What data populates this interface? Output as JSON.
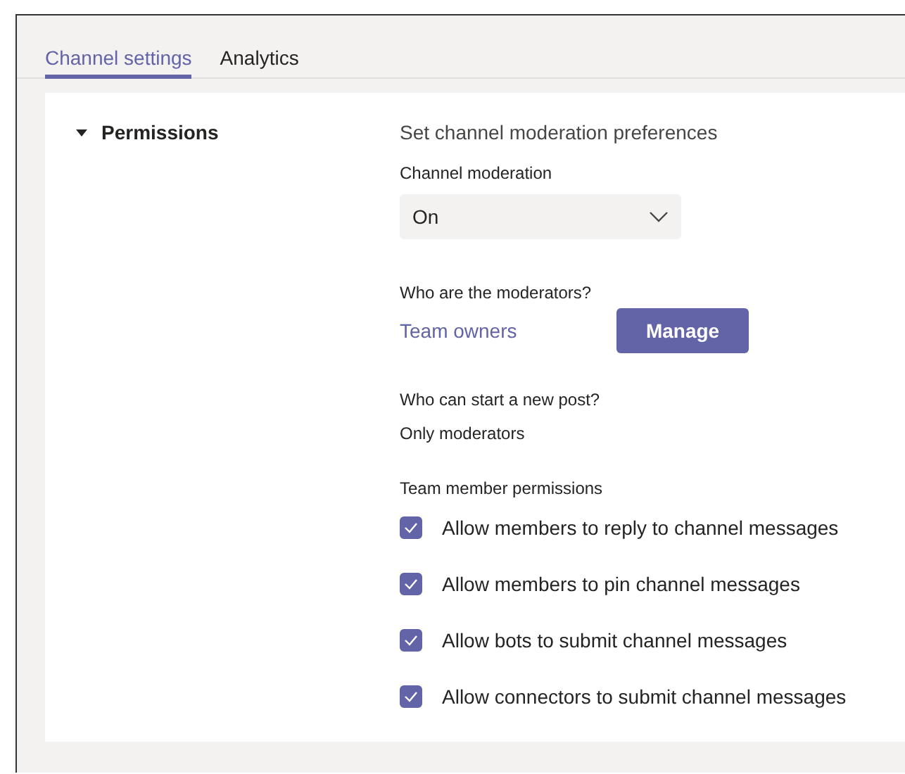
{
  "tabs": [
    {
      "label": "Channel settings",
      "selected": true
    },
    {
      "label": "Analytics",
      "selected": false
    }
  ],
  "section": {
    "title": "Permissions",
    "expanded": true,
    "description": "Set channel moderation preferences",
    "moderation": {
      "label": "Channel moderation",
      "value": "On"
    },
    "moderators": {
      "label": "Who are the moderators?",
      "value": "Team owners",
      "button": "Manage"
    },
    "new_post": {
      "label": "Who can start a new post?",
      "value": "Only moderators"
    },
    "permissions_label": "Team member permissions",
    "permissions": [
      {
        "label": "Allow members to reply to channel messages",
        "checked": true
      },
      {
        "label": "Allow members to pin channel messages",
        "checked": true
      },
      {
        "label": "Allow bots to submit channel messages",
        "checked": true
      },
      {
        "label": "Allow connectors to submit channel messages",
        "checked": true
      }
    ]
  }
}
